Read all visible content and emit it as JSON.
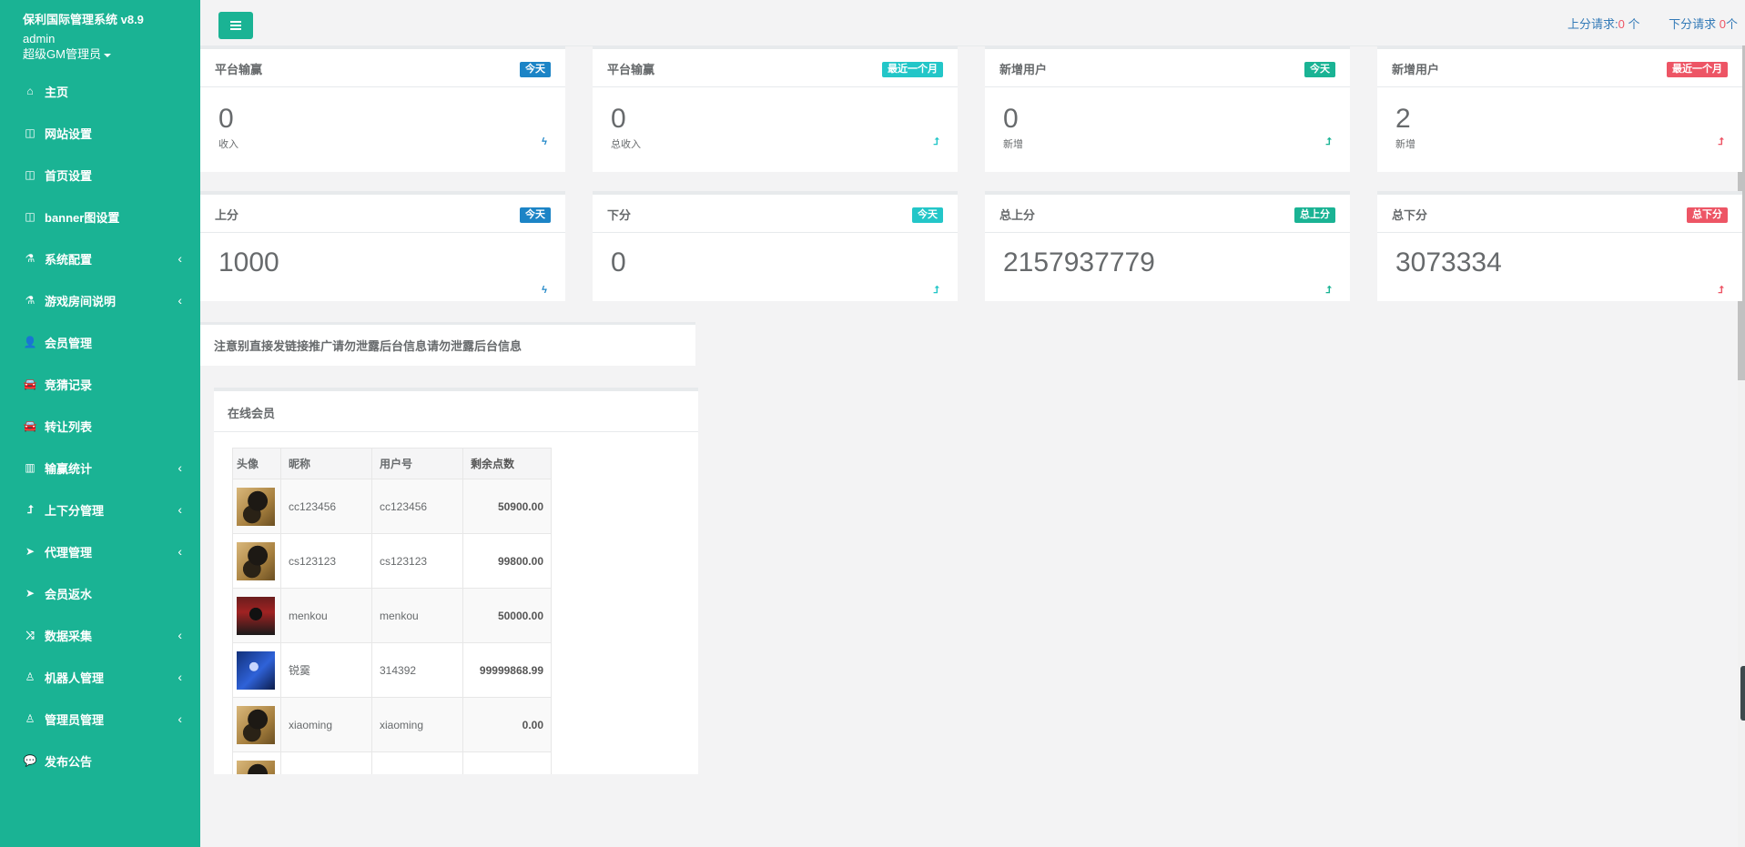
{
  "sidebar": {
    "title": "保利国际管理系统 v8.9",
    "user": "admin",
    "role": "超级GM管理员",
    "items": [
      {
        "label": "主页",
        "icon": "home-icon",
        "has_sub": false
      },
      {
        "label": "网站设置",
        "icon": "columns-icon",
        "has_sub": false
      },
      {
        "label": "首页设置",
        "icon": "columns-icon",
        "has_sub": false
      },
      {
        "label": "banner图设置",
        "icon": "columns-icon",
        "has_sub": false
      },
      {
        "label": "系统配置",
        "icon": "flask-icon",
        "has_sub": true
      },
      {
        "label": "游戏房间说明",
        "icon": "flask-icon",
        "has_sub": true
      },
      {
        "label": "会员管理",
        "icon": "user-icon",
        "has_sub": false
      },
      {
        "label": "竞猜记录",
        "icon": "car-icon",
        "has_sub": false
      },
      {
        "label": "转让列表",
        "icon": "car-icon",
        "has_sub": false
      },
      {
        "label": "输赢统计",
        "icon": "bar-chart-icon",
        "has_sub": true
      },
      {
        "label": "上下分管理",
        "icon": "level-up-icon",
        "has_sub": true
      },
      {
        "label": "代理管理",
        "icon": "paper-plane-icon",
        "has_sub": true
      },
      {
        "label": "会员返水",
        "icon": "paper-plane-icon",
        "has_sub": false
      },
      {
        "label": "数据采集",
        "icon": "random-icon",
        "has_sub": true
      },
      {
        "label": "机器人管理",
        "icon": "male-icon",
        "has_sub": true
      },
      {
        "label": "管理员管理",
        "icon": "male-icon",
        "has_sub": true
      },
      {
        "label": "发布公告",
        "icon": "comment-icon",
        "has_sub": false
      }
    ]
  },
  "topbar": {
    "up_label": "上分请求:",
    "up_count": "0",
    "up_unit": " 个",
    "down_label": "下分请求 ",
    "down_count": "0",
    "down_unit": "个"
  },
  "stats_row1": [
    {
      "title": "平台输赢",
      "badge": "今天",
      "badge_color": "#1c84c6",
      "value": "0",
      "sub": "收入",
      "icon": "bolt-icon"
    },
    {
      "title": "平台输赢",
      "badge": "最近一个月",
      "badge_color": "#23c6c8",
      "value": "0",
      "sub": "总收入",
      "icon": "level-up-icon"
    },
    {
      "title": "新增用户",
      "badge": "今天",
      "badge_color": "#1ab394",
      "value": "0",
      "sub": "新增",
      "icon": "level-up-icon"
    },
    {
      "title": "新增用户",
      "badge": "最近一个月",
      "badge_color": "#ed5565",
      "value": "2",
      "sub": "新增",
      "icon": "level-up-icon"
    }
  ],
  "stats_row2": [
    {
      "title": "上分",
      "badge": "今天",
      "badge_color": "#1c84c6",
      "value": "1000",
      "icon": "bolt-icon"
    },
    {
      "title": "下分",
      "badge": "今天",
      "badge_color": "#23c6c8",
      "value": "0",
      "icon": "level-up-icon"
    },
    {
      "title": "总上分",
      "badge": "总上分",
      "badge_color": "#1ab394",
      "value": "2157937779",
      "icon": "level-up-icon"
    },
    {
      "title": "总下分",
      "badge": "总下分",
      "badge_color": "#ed5565",
      "value": "3073334",
      "icon": "level-up-icon"
    }
  ],
  "notice": "注意别直接发链接推广请勿泄露后台信息请勿泄露后台信息",
  "online": {
    "title": "在线会员",
    "columns": [
      "头像",
      "昵称",
      "用户号",
      "剩余点数"
    ],
    "rows": [
      {
        "avatar": "avatar-dark-creature",
        "nickname": "cc123456",
        "uid": "cc123456",
        "points": "50900.00"
      },
      {
        "avatar": "avatar-dark-creature",
        "nickname": "cs123123",
        "uid": "cs123123",
        "points": "99800.00"
      },
      {
        "avatar": "avatar-red-hood",
        "nickname": "menkou",
        "uid": "menkou",
        "points": "50000.00"
      },
      {
        "avatar": "avatar-blue-hair",
        "nickname": "锐霙",
        "uid": "314392",
        "points": "99999868.99"
      },
      {
        "avatar": "avatar-dark-creature",
        "nickname": "xiaoming",
        "uid": "xiaoming",
        "points": "0.00"
      }
    ]
  }
}
